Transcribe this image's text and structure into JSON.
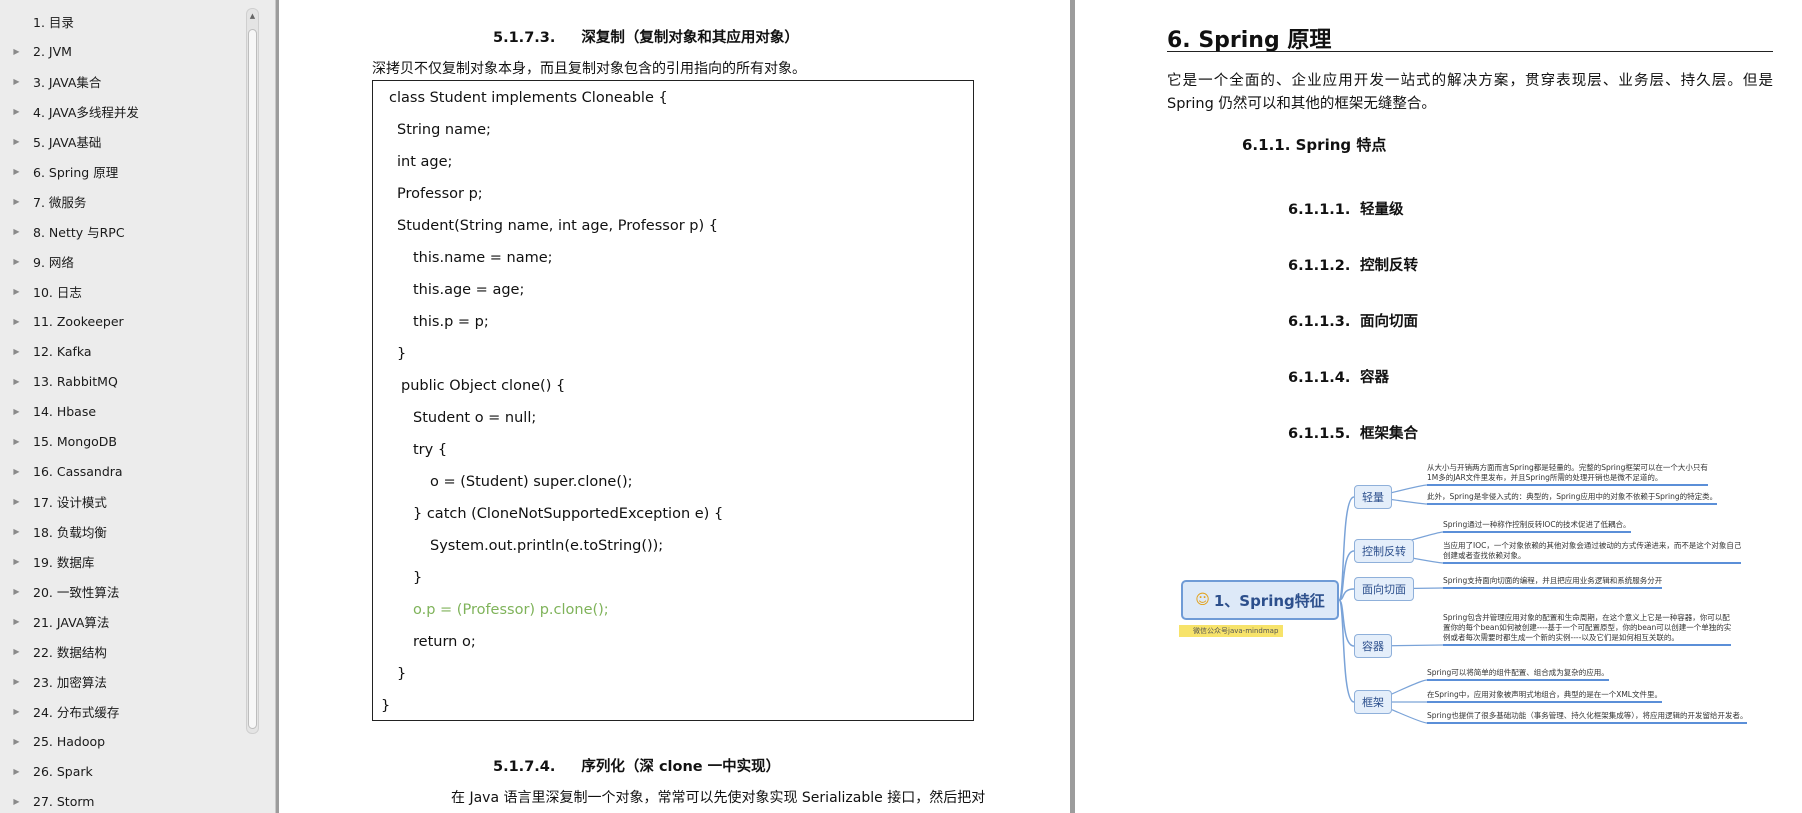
{
  "outline": [
    {
      "label": "1. 目录",
      "expandable": false
    },
    {
      "label": "2. JVM",
      "expandable": true
    },
    {
      "label": "3. JAVA集合",
      "expandable": true
    },
    {
      "label": "4. JAVA多线程并发",
      "expandable": true
    },
    {
      "label": "5. JAVA基础",
      "expandable": true
    },
    {
      "label": "6. Spring 原理",
      "expandable": true
    },
    {
      "label": "7.   微服务",
      "expandable": true
    },
    {
      "label": "8. Netty 与RPC",
      "expandable": true
    },
    {
      "label": "9. 网络",
      "expandable": true
    },
    {
      "label": "10. 日志",
      "expandable": true
    },
    {
      "label": "11. Zookeeper",
      "expandable": true
    },
    {
      "label": "12. Kafka",
      "expandable": true
    },
    {
      "label": "13. RabbitMQ",
      "expandable": true
    },
    {
      "label": "14. Hbase",
      "expandable": true
    },
    {
      "label": "15. MongoDB",
      "expandable": true
    },
    {
      "label": "16. Cassandra",
      "expandable": true
    },
    {
      "label": "17. 设计模式",
      "expandable": true
    },
    {
      "label": "18. 负载均衡",
      "expandable": true
    },
    {
      "label": "19. 数据库",
      "expandable": true
    },
    {
      "label": "20. 一致性算法",
      "expandable": true
    },
    {
      "label": "21. JAVA算法",
      "expandable": true
    },
    {
      "label": "22. 数据结构",
      "expandable": true
    },
    {
      "label": "23. 加密算法",
      "expandable": true
    },
    {
      "label": "24. 分布式缓存",
      "expandable": true
    },
    {
      "label": "25. Hadoop",
      "expandable": true
    },
    {
      "label": "26. Spark",
      "expandable": true
    },
    {
      "label": "27. Storm",
      "expandable": true
    }
  ],
  "left_page": {
    "heading1": {
      "num": "5.1.7.3.",
      "text": "深复制（复制对象和其应用对象）"
    },
    "intro": "深拷贝不仅复制对象本身，而且复制对象包含的引用指向的所有对象。",
    "code": [
      {
        "text": "class Student implements Cloneable {",
        "green": false
      },
      {
        "text": "String name;",
        "green": false
      },
      {
        "text": "int age;",
        "green": false
      },
      {
        "text": "Professor p;",
        "green": false
      },
      {
        "text": "Student(String name, int age, Professor p) {",
        "green": false
      },
      {
        "text": "this.name = name;",
        "green": false
      },
      {
        "text": "this.age = age;",
        "green": false
      },
      {
        "text": "this.p = p;",
        "green": false
      },
      {
        "text": "}",
        "green": false
      },
      {
        "text": "public Object clone() {",
        "green": false
      },
      {
        "text": "Student o = null;",
        "green": false
      },
      {
        "text": "try {",
        "green": false
      },
      {
        "text": "o = (Student) super.clone();",
        "green": false
      },
      {
        "text": "} catch (CloneNotSupportedException e) {",
        "green": false
      },
      {
        "text": "System.out.println(e.toString());",
        "green": false
      },
      {
        "text": "}",
        "green": false
      },
      {
        "text": "o.p = (Professor) p.clone();",
        "green": true
      },
      {
        "text": "return o;",
        "green": false
      },
      {
        "text": "}",
        "green": false
      },
      {
        "text": "}",
        "green": false
      }
    ],
    "heading2": {
      "num": "5.1.7.4.",
      "text": "序列化（深 clone 一中实现）"
    },
    "footer_para": "在 Java 语言里深复制一个对象，常常可以先使对象实现 Serializable 接口，然后把对"
  },
  "right_page": {
    "title": "6. Spring 原理",
    "intro": "它是一个全面的、企业应用开发一站式的解决方案，贯穿表现层、业务层、持久层。但是 Spring 仍然可以和其他的框架无缝整合。",
    "section": "6.1.1. Spring 特点",
    "subsections": [
      {
        "num": "6.1.1.1.",
        "text": "轻量级"
      },
      {
        "num": "6.1.1.2.",
        "text": "控制反转"
      },
      {
        "num": "6.1.1.3.",
        "text": "面向切面"
      },
      {
        "num": "6.1.1.4.",
        "text": "容器"
      },
      {
        "num": "6.1.1.5.",
        "text": "框架集合"
      }
    ],
    "mindmap": {
      "root": "1、Spring特征",
      "sticker": "微信公众号java-mindmap",
      "branches": [
        {
          "label": "轻量",
          "leaves": [
            "从大小与开销两方面而言Spring都是轻量的。完整的Spring框架可以在一个大小只有\n1M多的JAR文件里发布，并且Spring所需的处理开销也是微不足道的。",
            "此外，Spring是非侵入式的：典型的，Spring应用中的对象不依赖于Spring的特定类。"
          ]
        },
        {
          "label": "控制反转",
          "leaves": [
            "Spring通过一种称作控制反转IOC的技术促进了低耦合。",
            "当应用了IOC，一个对象依赖的其他对象会通过被动的方式传递进来，而不是这个对象自己\n创建或者查找依赖对象。"
          ]
        },
        {
          "label": "面向切面",
          "leaves": [
            "Spring支持面向切面的编程，并且把应用业务逻辑和系统服务分开"
          ]
        },
        {
          "label": "容器",
          "leaves": [
            "Spring包含并管理应用对象的配置和生命周期，在这个意义上它是一种容器，你可以配\n置你的每个bean如何被创建----基于一个可配置原型，你的bean可以创建一个单独的实\n例或者每次需要时都生成一个新的实例----以及它们是如何相互关联的。"
          ]
        },
        {
          "label": "框架",
          "leaves": [
            "Spring可以将简单的组件配置、组合成为复杂的应用。",
            "在Spring中，应用对象被声明式地组合，典型的是在一个XML文件里。",
            "Spring也提供了很多基础功能（事务管理、持久化框架集成等），将应用逻辑的开发留给开发者。"
          ]
        }
      ]
    }
  },
  "colors": {
    "accent": "#5b8fd8",
    "code_green": "#7fb35a",
    "viewer_bg": "#9c9c9c"
  }
}
